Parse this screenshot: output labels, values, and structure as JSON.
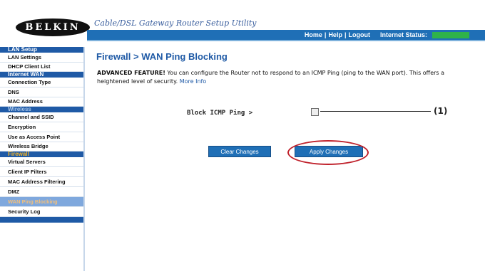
{
  "header": {
    "brand": "BELKIN",
    "app_title": "Cable/DSL Gateway Router Setup Utility",
    "links": [
      "Home",
      "Help",
      "Logout"
    ],
    "internet_status_label": "Internet Status:",
    "status_color": "#2fb34a"
  },
  "sidebar": {
    "sections": [
      {
        "title": "LAN Setup",
        "items": [
          "LAN Settings",
          "DHCP Client List"
        ]
      },
      {
        "title": "Internet WAN",
        "items": [
          "Connection Type",
          "DNS",
          "MAC Address"
        ]
      },
      {
        "title": "Wireless",
        "items": [
          "Channel and SSID",
          "Encryption",
          "Use as Access Point",
          "Wireless Bridge"
        ]
      },
      {
        "title": "Firewall",
        "items": [
          "Virtual Servers",
          "Client IP Filters",
          "MAC Address Filtering",
          "DMZ",
          "WAN Ping Blocking",
          "Security Log"
        ]
      }
    ],
    "active_item": "WAN Ping Blocking"
  },
  "main": {
    "title": "Firewall > WAN Ping Blocking",
    "advanced_label": "ADVANCED FEATURE!",
    "description": " You can configure the Router not to respond to an ICMP Ping (ping to the WAN port). This offers a heightened level of security.",
    "more_info": "More Info",
    "ping_label": "Block ICMP Ping >",
    "ping_checked": false,
    "callout": "(1)",
    "clear_button": "Clear Changes",
    "apply_button": "Apply Changes"
  },
  "colors": {
    "accent": "#1f6fb6",
    "highlight": "#c0222c",
    "firewall_header": "#f5b324"
  }
}
